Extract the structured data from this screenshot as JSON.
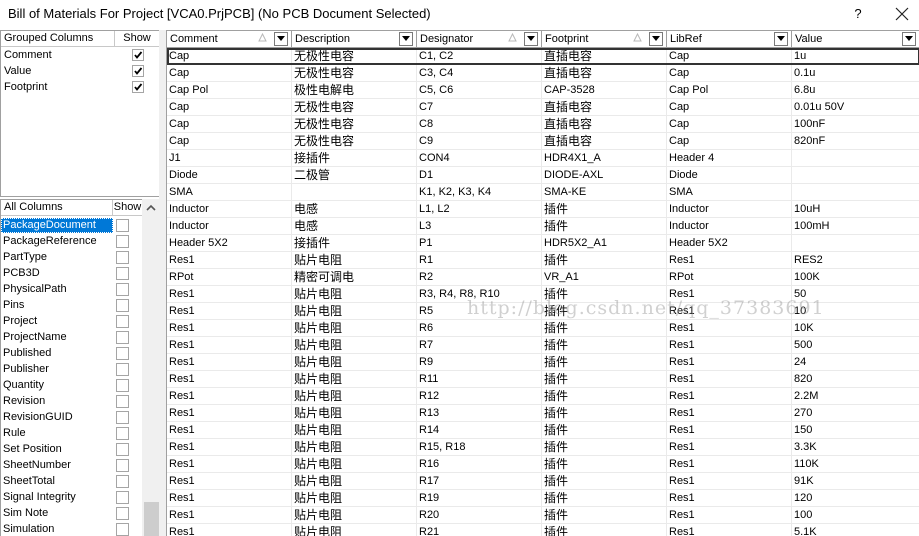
{
  "window": {
    "title": "Bill of Materials For Project [VCA0.PrjPCB] (No PCB Document Selected)",
    "help_label": "?",
    "close_icon": "close-icon"
  },
  "grouped_columns": {
    "header_name": "Grouped Columns",
    "header_show": "Show",
    "items": [
      {
        "label": "Comment",
        "checked": true
      },
      {
        "label": "Value",
        "checked": true
      },
      {
        "label": "Footprint",
        "checked": true
      }
    ]
  },
  "all_columns": {
    "header_name": "All Columns",
    "header_show": "Show",
    "selected": "PackageDocument",
    "items": [
      {
        "label": "PackageDocument",
        "checked": false
      },
      {
        "label": "PackageReference",
        "checked": false
      },
      {
        "label": "PartType",
        "checked": false
      },
      {
        "label": "PCB3D",
        "checked": false
      },
      {
        "label": "PhysicalPath",
        "checked": false
      },
      {
        "label": "Pins",
        "checked": false
      },
      {
        "label": "Project",
        "checked": false
      },
      {
        "label": "ProjectName",
        "checked": false
      },
      {
        "label": "Published",
        "checked": false
      },
      {
        "label": "Publisher",
        "checked": false
      },
      {
        "label": "Quantity",
        "checked": false
      },
      {
        "label": "Revision",
        "checked": false
      },
      {
        "label": "RevisionGUID",
        "checked": false
      },
      {
        "label": "Rule",
        "checked": false
      },
      {
        "label": "Set Position",
        "checked": false
      },
      {
        "label": "SheetNumber",
        "checked": false
      },
      {
        "label": "SheetTotal",
        "checked": false
      },
      {
        "label": "Signal Integrity",
        "checked": false
      },
      {
        "label": "Sim Note",
        "checked": false
      },
      {
        "label": "Simulation",
        "checked": false
      }
    ]
  },
  "grid": {
    "columns": [
      {
        "label": "Comment",
        "sorted": true
      },
      {
        "label": "Description",
        "sorted": false
      },
      {
        "label": "Designator",
        "sorted": true
      },
      {
        "label": "Footprint",
        "sorted": true
      },
      {
        "label": "LibRef",
        "sorted": false
      },
      {
        "label": "Value",
        "sorted": false
      }
    ],
    "rows": [
      [
        "Cap",
        "无极性电容",
        "C1, C2",
        "直插电容",
        "Cap",
        "1u"
      ],
      [
        "Cap",
        "无极性电容",
        "C3, C4",
        "直插电容",
        "Cap",
        "0.1u"
      ],
      [
        "Cap Pol",
        "极性电解电",
        "C5, C6",
        "CAP-3528",
        "Cap Pol",
        "6.8u"
      ],
      [
        "Cap",
        "无极性电容",
        "C7",
        "直插电容",
        "Cap",
        "0.01u 50V"
      ],
      [
        "Cap",
        "无极性电容",
        "C8",
        "直插电容",
        "Cap",
        "100nF"
      ],
      [
        "Cap",
        "无极性电容",
        "C9",
        "直插电容",
        "Cap",
        "820nF"
      ],
      [
        "J1",
        "接插件",
        "CON4",
        "HDR4X1_A",
        "Header 4",
        ""
      ],
      [
        "Diode",
        "二极管",
        "D1",
        "DIODE-AXL",
        "Diode",
        ""
      ],
      [
        "SMA",
        "",
        "K1, K2, K3, K4",
        "SMA-KE",
        "SMA",
        ""
      ],
      [
        "Inductor",
        "电感",
        "L1, L2",
        "插件",
        "Inductor",
        "10uH"
      ],
      [
        "Inductor",
        "电感",
        "L3",
        "插件",
        "Inductor",
        "100mH"
      ],
      [
        "Header 5X2",
        "接插件",
        "P1",
        "HDR5X2_A1",
        "Header 5X2",
        ""
      ],
      [
        "Res1",
        "贴片电阻",
        "R1",
        "插件",
        "Res1",
        "RES2"
      ],
      [
        "RPot",
        "精密可调电",
        "R2",
        "VR_A1",
        "RPot",
        "100K"
      ],
      [
        "Res1",
        "贴片电阻",
        "R3, R4, R8, R10",
        "插件",
        "Res1",
        "50"
      ],
      [
        "Res1",
        "贴片电阻",
        "R5",
        "插件",
        "Res1",
        "10"
      ],
      [
        "Res1",
        "贴片电阻",
        "R6",
        "插件",
        "Res1",
        "10K"
      ],
      [
        "Res1",
        "贴片电阻",
        "R7",
        "插件",
        "Res1",
        "500"
      ],
      [
        "Res1",
        "贴片电阻",
        "R9",
        "插件",
        "Res1",
        "24"
      ],
      [
        "Res1",
        "贴片电阻",
        "R11",
        "插件",
        "Res1",
        "820"
      ],
      [
        "Res1",
        "贴片电阻",
        "R12",
        "插件",
        "Res1",
        "2.2M"
      ],
      [
        "Res1",
        "贴片电阻",
        "R13",
        "插件",
        "Res1",
        "270"
      ],
      [
        "Res1",
        "贴片电阻",
        "R14",
        "插件",
        "Res1",
        "150"
      ],
      [
        "Res1",
        "贴片电阻",
        "R15, R18",
        "插件",
        "Res1",
        "3.3K"
      ],
      [
        "Res1",
        "贴片电阻",
        "R16",
        "插件",
        "Res1",
        "110K"
      ],
      [
        "Res1",
        "贴片电阻",
        "R17",
        "插件",
        "Res1",
        "91K"
      ],
      [
        "Res1",
        "贴片电阻",
        "R19",
        "插件",
        "Res1",
        "120"
      ],
      [
        "Res1",
        "贴片电阻",
        "R20",
        "插件",
        "Res1",
        "100"
      ],
      [
        "Res1",
        "贴片电阻",
        "R21",
        "插件",
        "Res1",
        "5.1K"
      ]
    ]
  },
  "watermark": "http://blog.csdn.net/qq_37383691"
}
